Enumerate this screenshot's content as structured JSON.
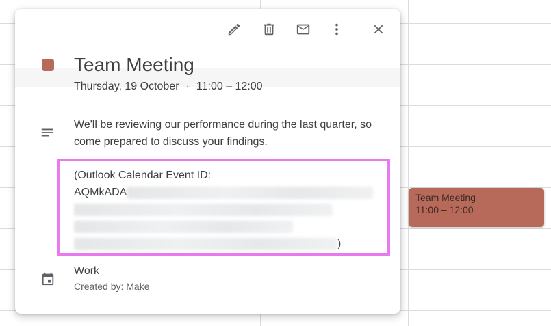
{
  "colors": {
    "event_color": "#b86a5a",
    "highlight": "#e879ef",
    "icon": "#5f6368",
    "text": "#3c4043",
    "grid_line": "#dadce0"
  },
  "toolbar": {
    "edit_icon": "pencil-icon",
    "delete_icon": "trash-icon",
    "email_icon": "envelope-icon",
    "more_icon": "more-vert-icon",
    "close_icon": "close-icon"
  },
  "event": {
    "title": "Team Meeting",
    "date": "Thursday, 19 October",
    "separator": "·",
    "time": "11:00 – 12:00",
    "description": "We'll be reviewing our performance during the last quarter, so come prepared to discuss your findings.",
    "outlook_label": "(Outlook Calendar Event ID:",
    "outlook_id_prefix": "AQMkADA",
    "outlook_close": ")",
    "calendar_name": "Work",
    "created_by": "Created by: Make"
  },
  "calendar_chip": {
    "title": "Team Meeting",
    "time": "11:00 – 12:00"
  }
}
